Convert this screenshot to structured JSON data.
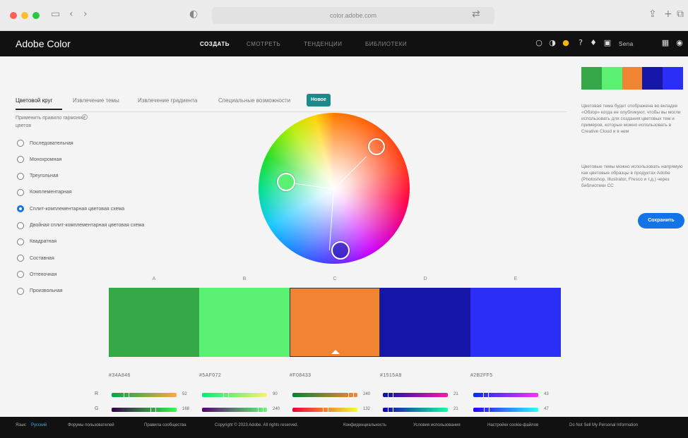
{
  "browser": {
    "url": "color.adobe.com",
    "traffic": [
      "#ff5f57",
      "#febc2e",
      "#28c840"
    ],
    "icons": [
      "sidebar-icon",
      "back-icon",
      "forward-icon",
      "privacy-icon",
      "translate-icon",
      "share-icon",
      "new-tab-icon",
      "tabs-overview-icon"
    ]
  },
  "header": {
    "logo": "Adobe Color",
    "nav": [
      "СОЗДАТЬ",
      "СМОТРЕТЬ",
      "ТЕНДЕНЦИИ",
      "БИБЛИОТЕКИ"
    ],
    "active_nav": "СОЗДАТЬ",
    "icons": [
      "creative-cloud-icon",
      "contrast-icon",
      "color-wheel-icon",
      "help-icon",
      "notifications-icon",
      "chat-icon",
      "apps-grid-icon"
    ],
    "user_label": "Sena"
  },
  "tabs": {
    "items": [
      "Цветовой круг",
      "Извлечение темы",
      "Извлечение градиента",
      "Специальные возможности"
    ],
    "active": "Цветовой круг",
    "badge": "Новое"
  },
  "rules": {
    "title": "Применить правило гармонии цветов",
    "options": [
      "Последовательная",
      "Монохромная",
      "Треугольная",
      "Комплементарная",
      "Сплит-комплементарная цветовая схема",
      "Двойная сплит-комплементарная цветовая схема",
      "Квадратная",
      "Составная",
      "Оттеночная",
      "Произвольная"
    ],
    "selected": "Сплит-комплементарная цветовая схема"
  },
  "swatches": [
    {
      "letter": "A",
      "color": "#34A846",
      "hex": "#34A846",
      "active": false
    },
    {
      "letter": "B",
      "color": "#5AF072",
      "hex": "#5AF072",
      "active": false
    },
    {
      "letter": "C",
      "color": "#F08433",
      "hex": "#F08433",
      "active": true
    },
    {
      "letter": "D",
      "color": "#1515A8",
      "hex": "#1515A8",
      "active": false
    },
    {
      "letter": "E",
      "color": "#2B2FF5",
      "hex": "#2B2FF5",
      "active": false
    }
  ],
  "rgb_channels": {
    "labels": [
      "R",
      "G"
    ],
    "values": [
      [
        "52",
        "168"
      ],
      [
        "90",
        "240"
      ],
      [
        "240",
        "132"
      ],
      [
        "21",
        "21"
      ],
      [
        "43",
        "47"
      ]
    ]
  },
  "right_panel": {
    "palette": [
      "#34A846",
      "#5AF072",
      "#F08433",
      "#1515A8",
      "#2B2FF5"
    ],
    "text1": "Цветовая тема будет отображена во вкладке «Обзор» когда ее опубликуют, чтобы вы могли использовать для создания цветовых тем и примеров, которые можно использовать в Creative Cloud и в нем",
    "text2": "Цветовые темы можно использовать напрямую как цветовые образцы в продуктах Adobe (Photoshop, Illustrator, Fresco и т.д.) через библиотеки CC",
    "save": "Сохранить"
  },
  "footer": {
    "language_label": "Язык:",
    "language": "Русский",
    "links": [
      "Форумы пользователей",
      "Правила сообщества",
      "Copyright © 2023 Adobe. All rights reserved.",
      "Конфиденциальность",
      "Условия использования",
      "Настройки cookie-файлов",
      "Do Not Sell My Personal Information"
    ]
  }
}
